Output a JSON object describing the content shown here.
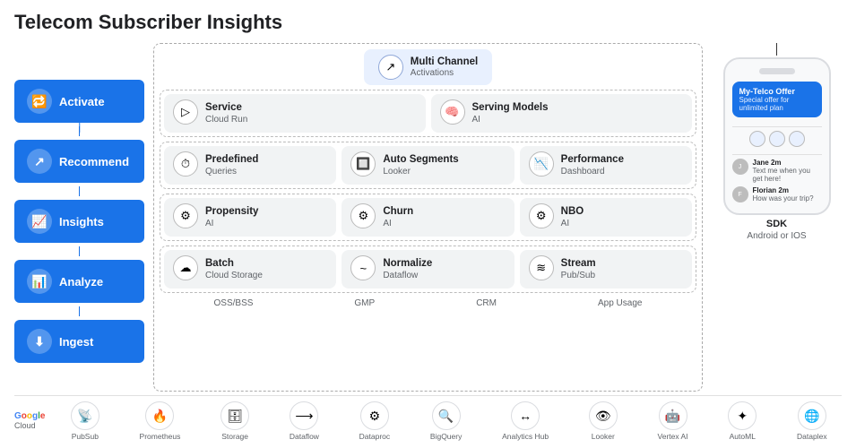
{
  "title": "Telecom Subscriber Insights",
  "sidebar": {
    "items": [
      {
        "label": "Activate",
        "icon": "🔁"
      },
      {
        "label": "Recommend",
        "icon": "↗"
      },
      {
        "label": "Insights",
        "icon": "📈"
      },
      {
        "label": "Analyze",
        "icon": "📊"
      },
      {
        "label": "Ingest",
        "icon": "⬇"
      }
    ]
  },
  "diagram": {
    "row0": {
      "cells": [
        {
          "icon": "↗",
          "title": "Multi Channel",
          "sub": "Activations"
        }
      ]
    },
    "row1": {
      "cells": [
        {
          "icon": "▷",
          "title": "Service",
          "sub": "Cloud Run"
        },
        {
          "icon": "🧠",
          "title": "Serving Models",
          "sub": "AI"
        }
      ]
    },
    "row2": {
      "cells": [
        {
          "icon": "⏱",
          "title": "Predefined",
          "sub": "Queries"
        },
        {
          "icon": "🔲",
          "title": "Auto Segments",
          "sub": "Looker"
        },
        {
          "icon": "📉",
          "title": "Performance",
          "sub": "Dashboard"
        }
      ]
    },
    "row3": {
      "cells": [
        {
          "icon": "⚙",
          "title": "Propensity",
          "sub": "AI"
        },
        {
          "icon": "⚙",
          "title": "Churn",
          "sub": "AI"
        },
        {
          "icon": "⚙",
          "title": "NBO",
          "sub": "AI"
        }
      ]
    },
    "row4": {
      "cells": [
        {
          "icon": "☁",
          "title": "Batch",
          "sub": "Cloud Storage"
        },
        {
          "icon": "~",
          "title": "Normalize",
          "sub": "Dataflow"
        },
        {
          "icon": "≋",
          "title": "Stream",
          "sub": "Pub/Sub"
        }
      ]
    },
    "labels": [
      "OSS/BSS",
      "GMP",
      "CRM",
      "App Usage"
    ]
  },
  "phone": {
    "offer_title": "My-Telco Offer",
    "offer_sub": "Special offer for unlimited plan",
    "messages": [
      {
        "name": "Jane 2m",
        "text": "Text me when you get here!"
      },
      {
        "name": "Florian 2m",
        "text": "How was your trip?"
      }
    ],
    "sdk_label": "SDK",
    "os_label": "Android or IOS"
  },
  "bottom_bar": {
    "logo": "Google Cloud",
    "icons": [
      {
        "label": "PubSub",
        "emoji": "📡"
      },
      {
        "label": "Prometheus",
        "emoji": "🔥"
      },
      {
        "label": "Storage",
        "emoji": "🗄"
      },
      {
        "label": "Dataflow",
        "emoji": "⟶"
      },
      {
        "label": "Dataproc",
        "emoji": "⚙"
      },
      {
        "label": "BigQuery",
        "emoji": "🔍"
      },
      {
        "label": "Analytics Hub",
        "emoji": "↔"
      },
      {
        "label": "Looker",
        "emoji": "👁"
      },
      {
        "label": "Vertex AI",
        "emoji": "🤖"
      },
      {
        "label": "AutoML",
        "emoji": "✦"
      },
      {
        "label": "Dataplex",
        "emoji": "🌐"
      }
    ]
  }
}
